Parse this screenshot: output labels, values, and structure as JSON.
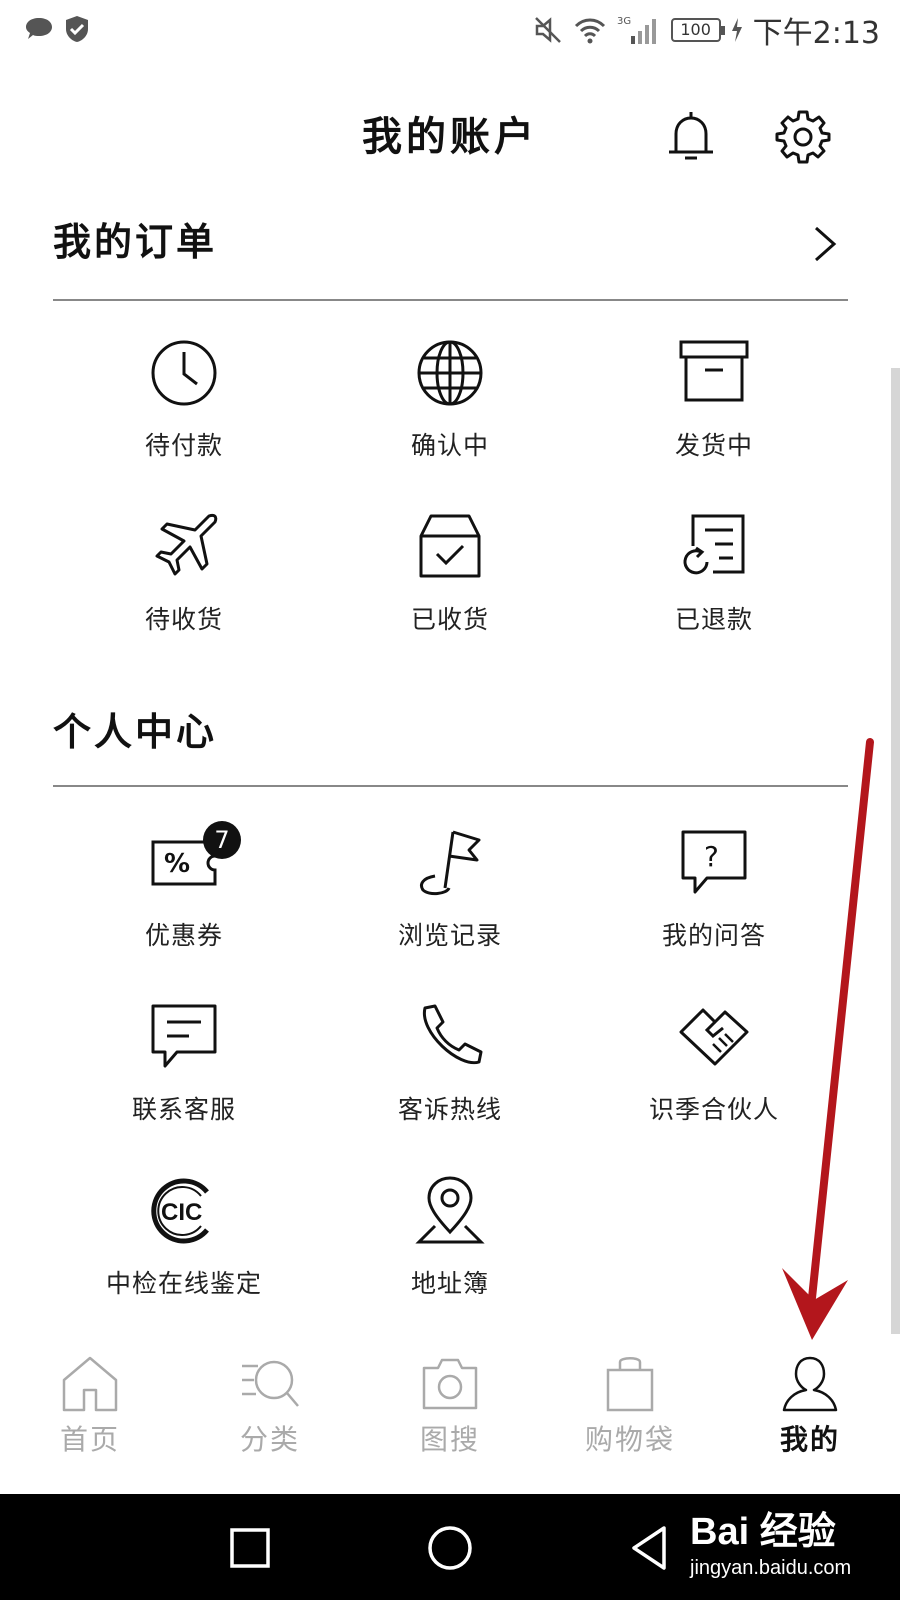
{
  "status_bar": {
    "time": "下午2:13",
    "network": "3G",
    "battery": "100",
    "icons": [
      "chat-bubble-icon",
      "shield-check-icon",
      "mute-icon",
      "wifi-icon",
      "signal-icon",
      "battery-icon",
      "charging-icon"
    ]
  },
  "header": {
    "title": "我的账户",
    "icons": [
      "bell-icon",
      "gear-icon"
    ]
  },
  "orders": {
    "title": "我的订单",
    "items": [
      {
        "label": "待付款",
        "icon": "clock-icon"
      },
      {
        "label": "确认中",
        "icon": "globe-icon"
      },
      {
        "label": "发货中",
        "icon": "box-icon"
      },
      {
        "label": "待收货",
        "icon": "airplane-icon"
      },
      {
        "label": "已收货",
        "icon": "received-box-icon"
      },
      {
        "label": "已退款",
        "icon": "refund-document-icon"
      }
    ]
  },
  "personal": {
    "title": "个人中心",
    "items": [
      {
        "label": "优惠券",
        "icon": "coupon-icon",
        "badge": "7"
      },
      {
        "label": "浏览记录",
        "icon": "flag-icon"
      },
      {
        "label": "我的问答",
        "icon": "question-bubble-icon"
      },
      {
        "label": "联系客服",
        "icon": "message-icon"
      },
      {
        "label": "客诉热线",
        "icon": "phone-icon"
      },
      {
        "label": "识季合伙人",
        "icon": "handshake-icon"
      },
      {
        "label": "中检在线鉴定",
        "icon": "cic-logo-icon",
        "logo_text": "CIC"
      },
      {
        "label": "地址簿",
        "icon": "location-pin-icon"
      }
    ]
  },
  "bottom_nav": {
    "items": [
      {
        "label": "首页",
        "icon": "home-icon",
        "active": false
      },
      {
        "label": "分类",
        "icon": "category-search-icon",
        "active": false
      },
      {
        "label": "图搜",
        "icon": "camera-icon",
        "active": false
      },
      {
        "label": "购物袋",
        "icon": "shopping-bag-icon",
        "active": false
      },
      {
        "label": "我的",
        "icon": "person-icon",
        "active": true
      }
    ]
  },
  "system_nav": {
    "icons": [
      "recent-apps-icon",
      "home-circle-icon",
      "back-triangle-icon"
    ]
  },
  "watermark": {
    "main": "Bai 经验",
    "sub": "jingyan.baidu.com"
  },
  "colors": {
    "annotation_arrow": "#b3161c",
    "active_nav": "#111111",
    "inactive_nav": "#aaaaaa",
    "badge": "#111111"
  }
}
